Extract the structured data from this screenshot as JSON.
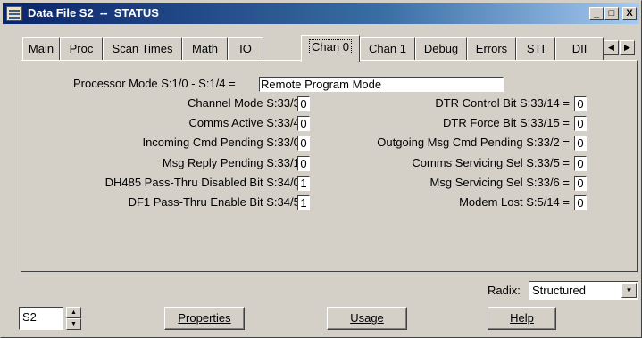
{
  "window": {
    "title": "Data File S2  --  STATUS",
    "buttons": {
      "minimize": "_",
      "maximize": "□",
      "close": "X"
    }
  },
  "tabs": [
    {
      "label": "Main",
      "active": false
    },
    {
      "label": "Proc",
      "active": false
    },
    {
      "label": "Scan Times",
      "active": false
    },
    {
      "label": "Math",
      "active": false
    },
    {
      "label": "IO",
      "active": false
    },
    {
      "label": "Chan 0",
      "active": true
    },
    {
      "label": "Chan 1",
      "active": false
    },
    {
      "label": "Debug",
      "active": false
    },
    {
      "label": "Errors",
      "active": false
    },
    {
      "label": "STI",
      "active": false
    },
    {
      "label": "DII",
      "active": false
    }
  ],
  "tab_scroll": {
    "left": "◀",
    "right": "▶"
  },
  "processor_mode": {
    "label": "Processor Mode S:1/0 - S:1/4 =",
    "value": "Remote Program Mode"
  },
  "left_fields": [
    {
      "label": "Channel Mode S:33/3 =",
      "value": "0"
    },
    {
      "label": "Comms Active S:33/4 =",
      "value": "0"
    },
    {
      "label": "Incoming Cmd Pending S:33/0 =",
      "value": "0"
    },
    {
      "label": "Msg Reply Pending S:33/1 =",
      "value": "0"
    },
    {
      "label": "DH485 Pass-Thru Disabled Bit S:34/0 =",
      "value": "1"
    },
    {
      "label": "DF1 Pass-Thru Enable Bit S:34/5 =",
      "value": "1"
    }
  ],
  "right_fields": [
    {
      "label": "DTR Control Bit S:33/14 =",
      "value": "0"
    },
    {
      "label": "DTR Force  Bit S:33/15 =",
      "value": "0"
    },
    {
      "label": "Outgoing Msg Cmd Pending S:33/2 =",
      "value": "0"
    },
    {
      "label": "Comms Servicing Sel S:33/5 =",
      "value": "0"
    },
    {
      "label": "Msg Servicing Sel S:33/6 =",
      "value": "0"
    },
    {
      "label": "Modem Lost S:5/14 =",
      "value": "0"
    }
  ],
  "radix": {
    "label": "Radix:",
    "value": "Structured"
  },
  "file_selector": {
    "value": "S2",
    "up": "▲",
    "down": "▼"
  },
  "buttons": {
    "properties": "Properties",
    "usage": "Usage",
    "help": "Help"
  },
  "combo_arrow": "▼"
}
